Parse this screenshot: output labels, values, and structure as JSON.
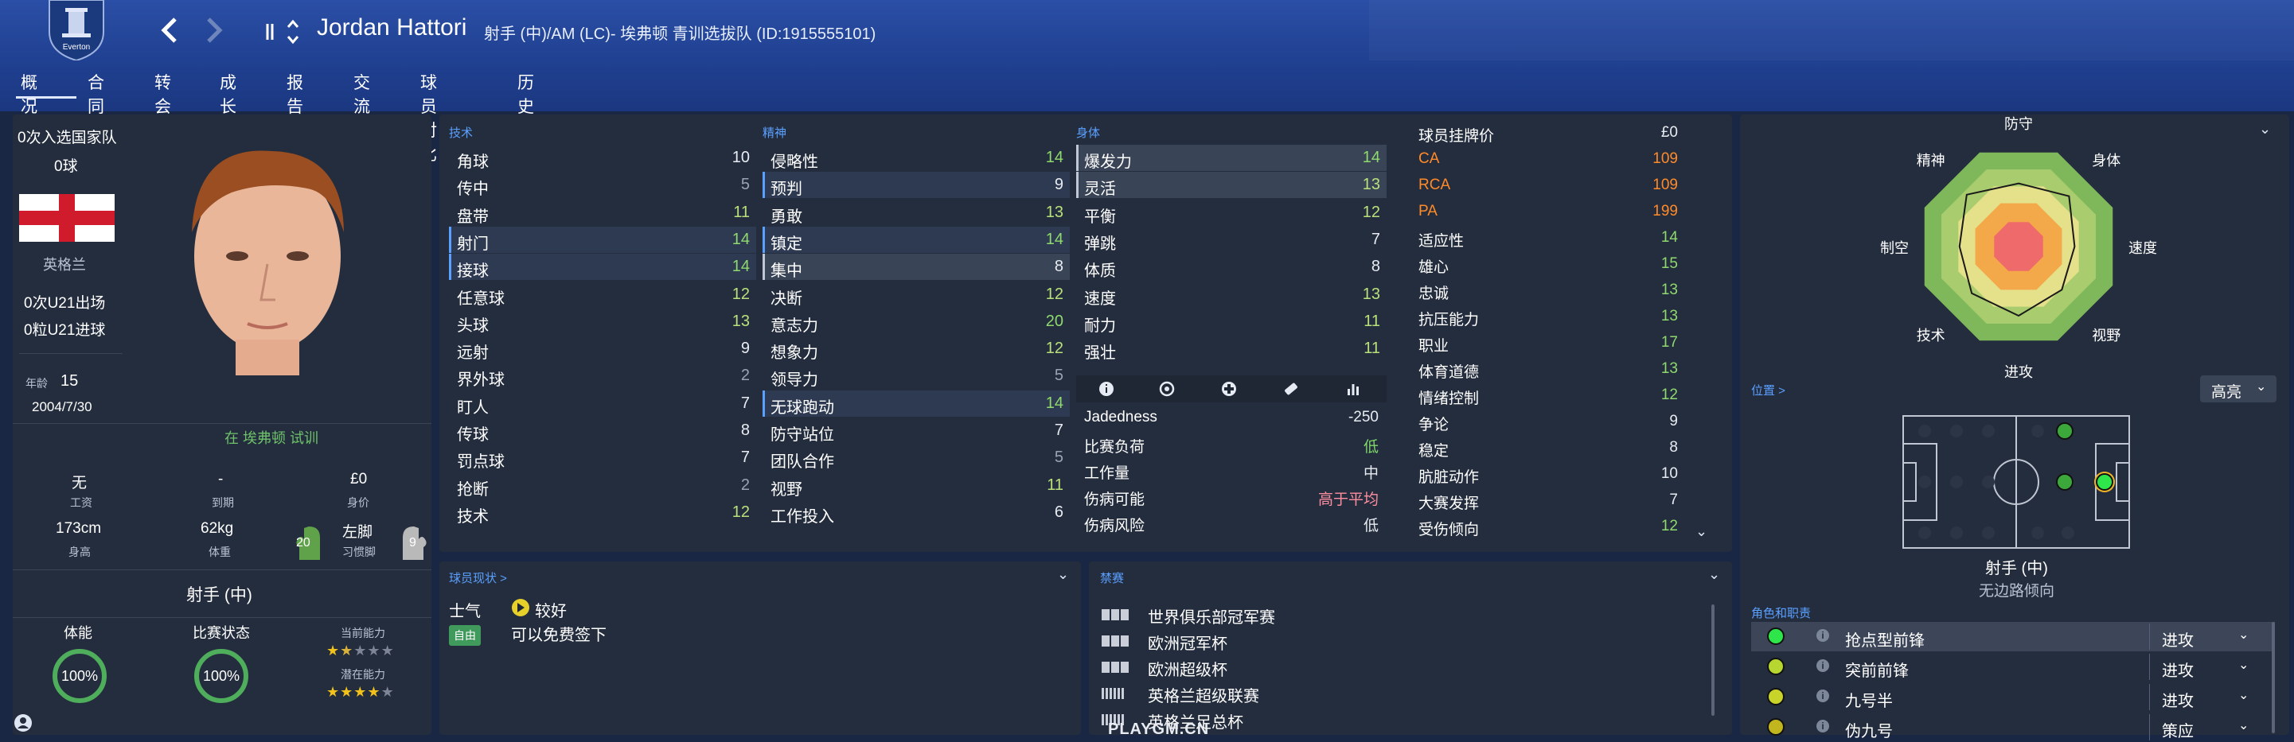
{
  "header": {
    "player_name": "Jordan Hattori",
    "subtitle": "射手 (中)/AM (LC)- 埃弗顿 青训选拔队 (ID:1915555101)",
    "club_crest_label": "Everton",
    "back_icon": "chevron-left-icon",
    "forward_icon": "chevron-right-icon",
    "sort_icon": "sort-updown-icon"
  },
  "menu": [
    {
      "label": "概况"
    },
    {
      "label": "合同"
    },
    {
      "label": "转会"
    },
    {
      "label": "成长"
    },
    {
      "label": "报告"
    },
    {
      "label": "交流"
    },
    {
      "label": "球员对比"
    },
    {
      "label": "历史"
    }
  ],
  "left": {
    "caps": "0次入选国家队",
    "goals": "0球",
    "nation": "英格兰",
    "u21_apps": "0次U21出场",
    "u21_goals": "0粒U21进球",
    "age_label": "年龄",
    "age": "15",
    "dob": "2004/7/30",
    "trial_text": "在 埃弗顿 试训",
    "wage_value": "无",
    "wage_label": "工资",
    "expiry_value": "-",
    "expiry_label": "到期",
    "value_value": "£0",
    "value_label": "身价",
    "height_value": "173cm",
    "height_label": "身高",
    "weight_value": "62kg",
    "weight_label": "体重",
    "left_foot_rating": "20",
    "foot_value": "左脚",
    "foot_label": "习惯脚",
    "right_foot_rating": "9",
    "position": "射手 (中)",
    "fitness_label": "体能",
    "fitness_value": "100%",
    "match_label": "比赛状态",
    "match_value": "100%",
    "current_ability_label": "当前能力",
    "potential_ability_label": "潜在能力",
    "current_stars": 1.5,
    "potential_stars": 4
  },
  "attributes": {
    "technical_title": "技术",
    "mental_title": "精神",
    "physical_title": "身体",
    "technical": [
      {
        "n": "角球",
        "v": "10",
        "c": "white"
      },
      {
        "n": "传中",
        "v": "5",
        "c": "grey"
      },
      {
        "n": "盘带",
        "v": "11",
        "c": "lg"
      },
      {
        "n": "射门",
        "v": "14",
        "c": "green",
        "hl": 1
      },
      {
        "n": "接球",
        "v": "14",
        "c": "green",
        "hl": 1
      },
      {
        "n": "任意球",
        "v": "12",
        "c": "lg"
      },
      {
        "n": "头球",
        "v": "13",
        "c": "lg"
      },
      {
        "n": "远射",
        "v": "9",
        "c": "white"
      },
      {
        "n": "界外球",
        "v": "2",
        "c": "grey"
      },
      {
        "n": "盯人",
        "v": "7",
        "c": "white"
      },
      {
        "n": "传球",
        "v": "8",
        "c": "white"
      },
      {
        "n": "罚点球",
        "v": "7",
        "c": "white"
      },
      {
        "n": "抢断",
        "v": "2",
        "c": "grey"
      },
      {
        "n": "技术",
        "v": "12",
        "c": "lg"
      }
    ],
    "mental": [
      {
        "n": "侵略性",
        "v": "14",
        "c": "green"
      },
      {
        "n": "预判",
        "v": "9",
        "c": "white",
        "hl": 1
      },
      {
        "n": "勇敢",
        "v": "13",
        "c": "lg"
      },
      {
        "n": "镇定",
        "v": "14",
        "c": "green",
        "hl": 1
      },
      {
        "n": "集中",
        "v": "8",
        "c": "white",
        "hlp": 1
      },
      {
        "n": "决断",
        "v": "12",
        "c": "lg"
      },
      {
        "n": "意志力",
        "v": "20",
        "c": "green"
      },
      {
        "n": "想象力",
        "v": "12",
        "c": "lg"
      },
      {
        "n": "领导力",
        "v": "5",
        "c": "grey"
      },
      {
        "n": "无球跑动",
        "v": "14",
        "c": "green",
        "hl": 1
      },
      {
        "n": "防守站位",
        "v": "7",
        "c": "white"
      },
      {
        "n": "团队合作",
        "v": "5",
        "c": "grey"
      },
      {
        "n": "视野",
        "v": "11",
        "c": "lg"
      },
      {
        "n": "工作投入",
        "v": "6",
        "c": "white"
      }
    ],
    "physical": [
      {
        "n": "爆发力",
        "v": "14",
        "c": "green",
        "hlp": 1
      },
      {
        "n": "灵活",
        "v": "13",
        "c": "lg",
        "hlp": 1
      },
      {
        "n": "平衡",
        "v": "12",
        "c": "lg"
      },
      {
        "n": "弹跳",
        "v": "7",
        "c": "white"
      },
      {
        "n": "体质",
        "v": "8",
        "c": "white"
      },
      {
        "n": "速度",
        "v": "13",
        "c": "lg"
      },
      {
        "n": "耐力",
        "v": "11",
        "c": "lg"
      },
      {
        "n": "强壮",
        "v": "11",
        "c": "lg"
      }
    ],
    "physical_icons": [
      "info-icon",
      "soccer-ball-icon",
      "medical-cross-icon",
      "bandage-icon",
      "bar-chart-icon"
    ],
    "extra": [
      {
        "n": "Jadedness",
        "v": "-250",
        "c": "white"
      },
      {
        "n": "比赛负荷",
        "v": "低",
        "c": "green"
      },
      {
        "n": "工作量",
        "v": "中",
        "c": "white"
      },
      {
        "n": "伤病可能",
        "v": "高于平均",
        "c": "pink"
      },
      {
        "n": "伤病风险",
        "v": "低",
        "c": "white"
      }
    ]
  },
  "info": [
    {
      "n": "球员挂牌价",
      "v": "£0",
      "c": "white"
    },
    {
      "n": "CA",
      "v": "109",
      "c": "orange"
    },
    {
      "n": "RCA",
      "v": "109",
      "c": "orange"
    },
    {
      "n": "PA",
      "v": "199",
      "c": "orange"
    },
    {
      "n": "适应性",
      "v": "14",
      "c": "green"
    },
    {
      "n": "雄心",
      "v": "15",
      "c": "green"
    },
    {
      "n": "忠诚",
      "v": "13",
      "c": "green"
    },
    {
      "n": "抗压能力",
      "v": "13",
      "c": "green"
    },
    {
      "n": "职业",
      "v": "17",
      "c": "green"
    },
    {
      "n": "体育道德",
      "v": "13",
      "c": "green"
    },
    {
      "n": "情绪控制",
      "v": "12",
      "c": "green"
    },
    {
      "n": "争论",
      "v": "9",
      "c": "white"
    },
    {
      "n": "稳定",
      "v": "8",
      "c": "white"
    },
    {
      "n": "肮脏动作",
      "v": "10",
      "c": "white"
    },
    {
      "n": "大赛发挥",
      "v": "7",
      "c": "white"
    },
    {
      "n": "受伤倾向",
      "v": "12",
      "c": "green"
    }
  ],
  "radar": {
    "labels": [
      "防守",
      "身体",
      "速度",
      "视野",
      "进攻",
      "技术",
      "制空",
      "精神"
    ],
    "values": [
      0.62,
      0.7,
      0.55,
      0.6,
      0.68,
      0.65,
      0.58,
      0.72
    ]
  },
  "position_panel": {
    "title": "位置 >",
    "highlight_button": "高亮",
    "position": "射手 (中)",
    "tendency": "无边路倾向"
  },
  "roles": {
    "title": "角色和职责",
    "items": [
      {
        "n": "抢点型前锋",
        "d": "进攻",
        "color": "#2ee64a"
      },
      {
        "n": "突前前锋",
        "d": "进攻",
        "color": "#b7d630"
      },
      {
        "n": "九号半",
        "d": "进攻",
        "color": "#c9d42a"
      },
      {
        "n": "伪九号",
        "d": "策应",
        "color": "#c2b61e"
      }
    ]
  },
  "status": {
    "title": "球员现状 >",
    "morale_label": "士气",
    "morale_value": "较好",
    "free_badge": "自由",
    "free_text": "可以免费签下"
  },
  "competitions": {
    "title": "禁赛",
    "items": [
      "世界俱乐部冠军赛",
      "欧洲冠军杯",
      "欧洲超级杯",
      "英格兰超级联赛",
      "英格兰足总杯"
    ]
  },
  "watermark": "PLAYGM.CN"
}
